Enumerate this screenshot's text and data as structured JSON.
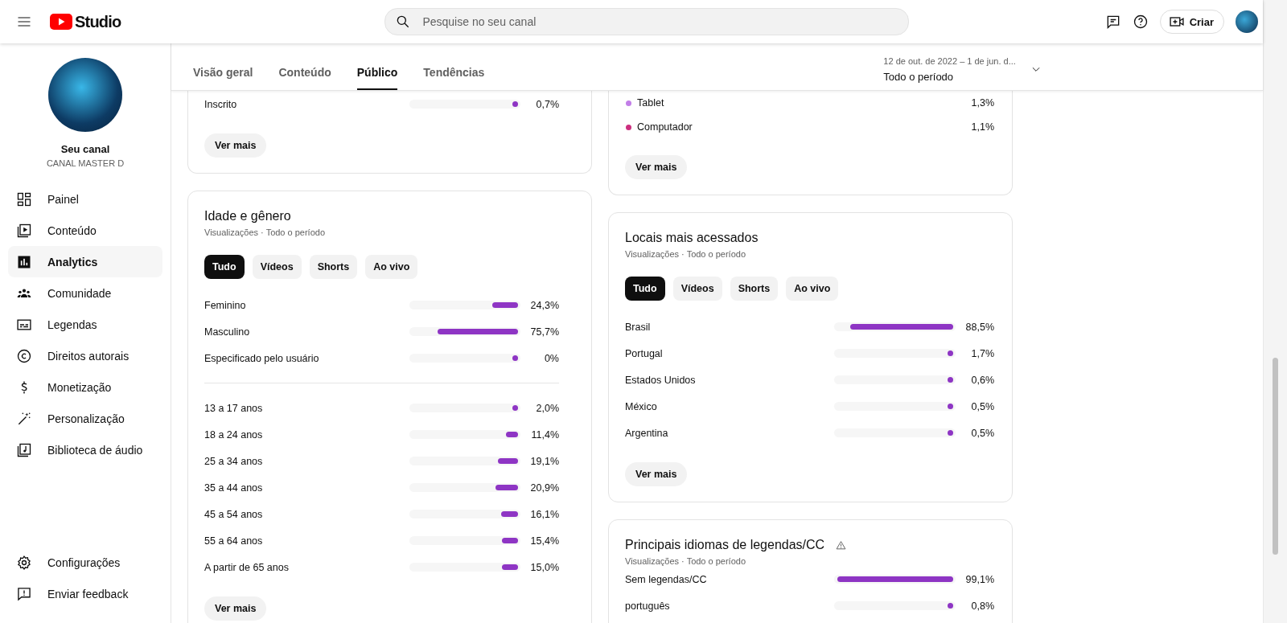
{
  "header": {
    "logo_text": "Studio",
    "search": {
      "placeholder": "Pesquise no seu canal"
    },
    "create_button": "Criar"
  },
  "sidebar": {
    "channel_title": "Seu canal",
    "channel_name": "CANAL MASTER D",
    "items": [
      {
        "label": "Painel",
        "selected": false
      },
      {
        "label": "Conteúdo",
        "selected": false
      },
      {
        "label": "Analytics",
        "selected": true
      },
      {
        "label": "Comunidade",
        "selected": false
      },
      {
        "label": "Legendas",
        "selected": false
      },
      {
        "label": "Direitos autorais",
        "selected": false
      },
      {
        "label": "Monetização",
        "selected": false
      },
      {
        "label": "Personalização",
        "selected": false
      },
      {
        "label": "Biblioteca de áudio",
        "selected": false
      }
    ],
    "footer_items": [
      {
        "label": "Configurações"
      },
      {
        "label": "Enviar feedback"
      }
    ]
  },
  "tabs": [
    {
      "label": "Visão geral",
      "selected": false
    },
    {
      "label": "Conteúdo",
      "selected": false
    },
    {
      "label": "Público",
      "selected": true
    },
    {
      "label": "Tendências",
      "selected": false
    }
  ],
  "date_range": {
    "range": "12 de out. de 2022 – 1 de jun. d...",
    "period": "Todo o período"
  },
  "left_column": [
    {
      "sections": [
        {
          "rows": [
            {
              "kind": "bar",
              "label": "Inscrito",
              "value": "0,7%",
              "level": 0.007
            }
          ]
        }
      ],
      "button": "Ver mais"
    },
    {
      "title": "Idade e gênero",
      "subtitle": "Visualizações · Todo o período",
      "filters": [
        {
          "label": "Tudo",
          "selected": true
        },
        {
          "label": "Vídeos",
          "selected": false
        },
        {
          "label": "Shorts",
          "selected": false
        },
        {
          "label": "Ao vivo",
          "selected": false
        }
      ],
      "sections": [
        {
          "rows": [
            {
              "kind": "bar",
              "label": "Feminino",
              "value": "24,3%",
              "level": 0.243
            },
            {
              "kind": "bar",
              "label": "Masculino",
              "value": "75,7%",
              "level": 0.757
            },
            {
              "kind": "bar",
              "label": "Especificado pelo usuário",
              "value": "0%",
              "level": 0
            }
          ]
        },
        {
          "rows": [
            {
              "kind": "bar",
              "label": "13 a 17 anos",
              "value": "2,0%",
              "level": 0.02
            },
            {
              "kind": "bar",
              "label": "18 a 24 anos",
              "value": "11,4%",
              "level": 0.114
            },
            {
              "kind": "bar",
              "label": "25 a 34 anos",
              "value": "19,1%",
              "level": 0.191
            },
            {
              "kind": "bar",
              "label": "35 a 44 anos",
              "value": "20,9%",
              "level": 0.209
            },
            {
              "kind": "bar",
              "label": "45 a 54 anos",
              "value": "16,1%",
              "level": 0.161
            },
            {
              "kind": "bar",
              "label": "55 a 64 anos",
              "value": "15,4%",
              "level": 0.154
            },
            {
              "kind": "bar",
              "label": "A partir de 65 anos",
              "value": "15,0%",
              "level": 0.15
            }
          ]
        }
      ],
      "button": "Ver mais"
    }
  ],
  "right_column": [
    {
      "sections": [
        {
          "rows": [
            {
              "kind": "legend",
              "label": "Tablet",
              "value": "1,3%",
              "color": "#c27ee8"
            },
            {
              "kind": "legend",
              "label": "Computador",
              "value": "1,1%",
              "color": "#cc2f7f"
            }
          ]
        }
      ],
      "button": "Ver mais"
    },
    {
      "title": "Locais mais acessados",
      "subtitle": "Visualizações · Todo o período",
      "filters": [
        {
          "label": "Tudo",
          "selected": true
        },
        {
          "label": "Vídeos",
          "selected": false
        },
        {
          "label": "Shorts",
          "selected": false
        },
        {
          "label": "Ao vivo",
          "selected": false
        }
      ],
      "sections": [
        {
          "rows": [
            {
              "kind": "bar",
              "label": "Brasil",
              "value": "88,5%",
              "level": 0.885
            },
            {
              "kind": "bar",
              "label": "Portugal",
              "value": "1,7%",
              "level": 0.017
            },
            {
              "kind": "bar",
              "label": "Estados Unidos",
              "value": "0,6%",
              "level": 0.006
            },
            {
              "kind": "bar",
              "label": "México",
              "value": "0,5%",
              "level": 0.005
            },
            {
              "kind": "bar",
              "label": "Argentina",
              "value": "0,5%",
              "level": 0.005
            }
          ]
        }
      ],
      "button": "Ver mais"
    },
    {
      "title": "Principais idiomas de legendas/CC",
      "warning": true,
      "subtitle": "Visualizações · Todo o período",
      "sections": [
        {
          "rows": [
            {
              "kind": "bar",
              "label": "Sem legendas/CC",
              "value": "99,1%",
              "level": 0.991
            },
            {
              "kind": "bar",
              "label": "português",
              "value": "0,8%",
              "level": 0.008
            }
          ]
        }
      ]
    }
  ]
}
